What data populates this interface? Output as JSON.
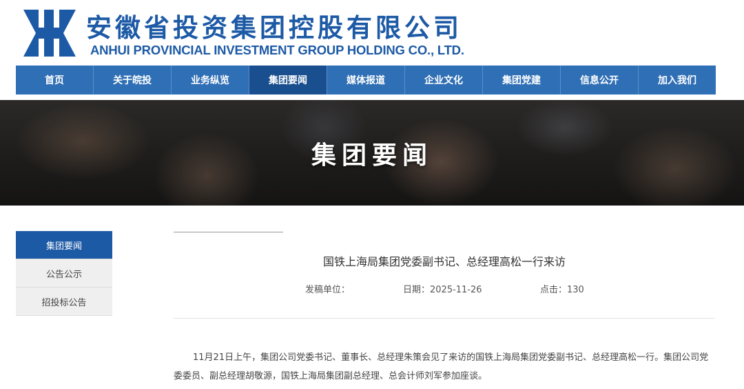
{
  "header": {
    "company_cn": "安徽省投资集团控股有限公司",
    "company_en": "ANHUI PROVINCIAL INVESTMENT GROUP HOLDING CO., LTD.",
    "brand_color": "#1d5aa6"
  },
  "nav": {
    "items": [
      {
        "label": "首页"
      },
      {
        "label": "关于皖投"
      },
      {
        "label": "业务纵览"
      },
      {
        "label": "集团要闻"
      },
      {
        "label": "媒体报道"
      },
      {
        "label": "企业文化"
      },
      {
        "label": "集团党建"
      },
      {
        "label": "信息公开"
      },
      {
        "label": "加入我们"
      }
    ],
    "active": "集团要闻"
  },
  "banner": {
    "title": "集团要闻"
  },
  "sidebar": {
    "items": [
      {
        "label": "集团要闻"
      },
      {
        "label": "公告公示"
      },
      {
        "label": "招投标公告"
      }
    ],
    "active": "集团要闻"
  },
  "article": {
    "title": "国铁上海局集团党委副书记、总经理高松一行来访",
    "unit_label": "发稿单位：",
    "date_label": "日期：2025-11-26",
    "clicks_label": "点击：130",
    "body": "11月21日上午，集团公司党委书记、董事长、总经理朱策会见了来访的国铁上海局集团党委副书记、总经理高松一行。集团公司党委委员、副总经理胡敬源，国铁上海局集团副总经理、总会计师刘军参加座谈。"
  }
}
